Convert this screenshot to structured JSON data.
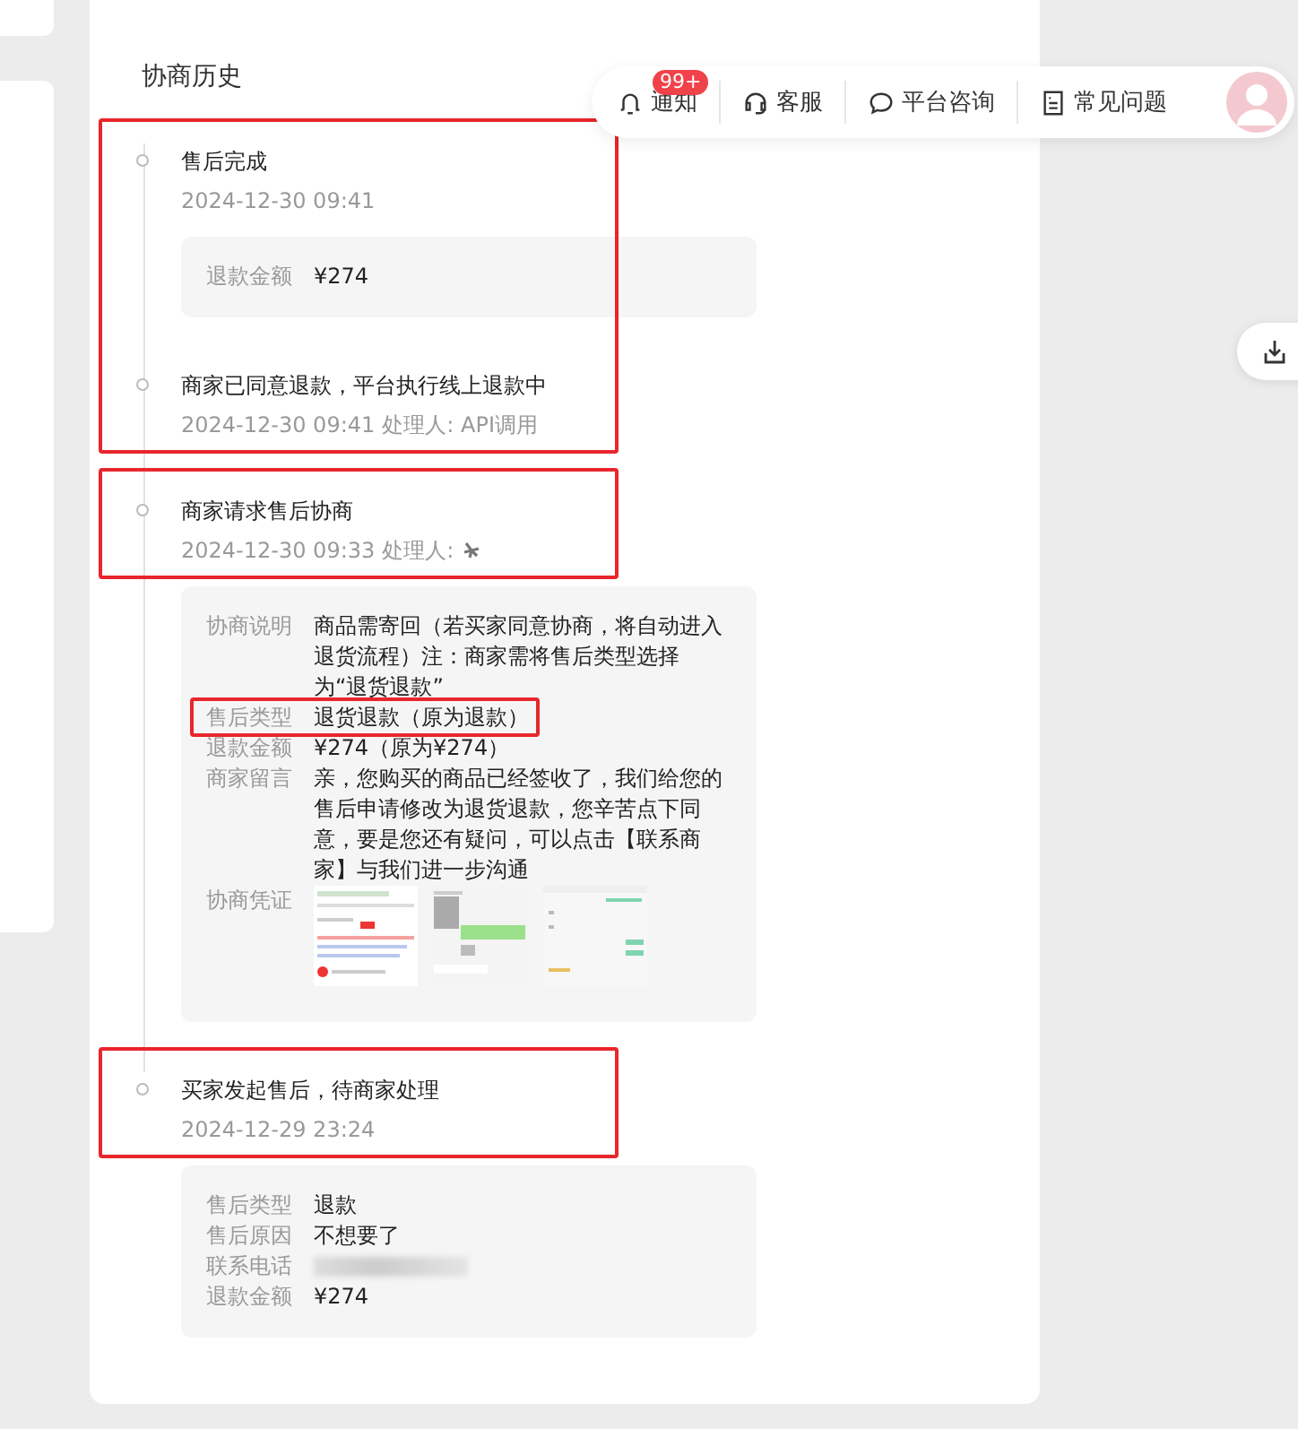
{
  "section_title": "协商历史",
  "header_bar": {
    "items": [
      {
        "kind": "bell",
        "label": "通知",
        "badge": "99+"
      },
      {
        "kind": "headset",
        "label": "客服"
      },
      {
        "kind": "chat",
        "label": "平台咨询"
      },
      {
        "kind": "doc",
        "label": "常见问题"
      }
    ]
  },
  "timeline": [
    {
      "highlighted": true,
      "events": [
        {
          "title": "售后完成",
          "time": "2024-12-30 09:41",
          "details": [
            {
              "kind": "text",
              "label": "退款金额",
              "value": "¥274"
            }
          ]
        },
        {
          "title": "商家已同意退款，平台执行线上退款中",
          "time": "2024-12-30 09:41",
          "handler": "处理人: API调用"
        }
      ]
    },
    {
      "highlighted": true,
      "events": [
        {
          "title": "商家请求售后协商",
          "time": "2024-12-30 09:33",
          "handler": "处理人:",
          "handler_avatar": true,
          "details": [
            {
              "kind": "text",
              "label": "协商说明",
              "value": "商品需寄回（若买家同意协商，将自动进入退货流程）注：商家需将售后类型选择为“退货退款”"
            },
            {
              "kind": "text",
              "label": "售后类型",
              "value": "退货退款（原为退款）",
              "highlighted": true
            },
            {
              "kind": "text",
              "label": "退款金额",
              "value": "¥274（原为¥274）"
            },
            {
              "kind": "text",
              "label": "商家留言",
              "value": "亲，您购买的商品已经签收了，我们给您的售后申请修改为退货退款，您辛苦点下同意，要是您还有疑问，可以点击【联系商家】与我们进一步沟通"
            },
            {
              "kind": "images",
              "label": "协商凭证"
            }
          ]
        }
      ]
    },
    {
      "highlighted": true,
      "events": [
        {
          "title": "买家发起售后，待商家处理",
          "time": "2024-12-29 23:24",
          "details": [
            {
              "kind": "text",
              "label": "售后类型",
              "value": "退款"
            },
            {
              "kind": "text",
              "label": "售后原因",
              "value": "不想要了"
            },
            {
              "kind": "redacted",
              "label": "联系电话"
            },
            {
              "kind": "text",
              "label": "退款金额",
              "value": "¥274"
            }
          ]
        }
      ]
    }
  ]
}
